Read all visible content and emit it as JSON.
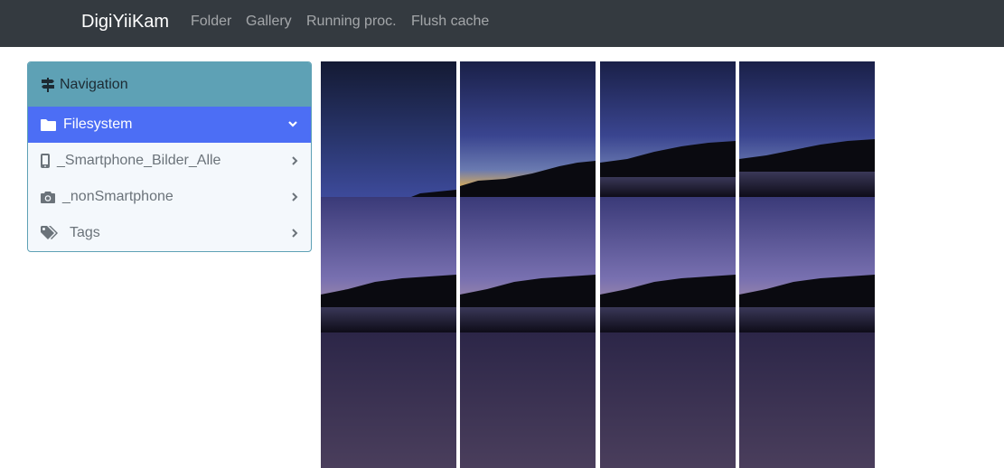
{
  "navbar": {
    "brand": "DigiYiiKam",
    "links": [
      "Folder",
      "Gallery",
      "Running proc.",
      "Flush cache"
    ]
  },
  "sidebar": {
    "header": {
      "label": "Navigation",
      "icon": "signpost-icon"
    },
    "items": [
      {
        "label": "Filesystem",
        "icon": "folder-icon",
        "active": true,
        "chevron": "chevron-down-icon"
      },
      {
        "label": "_Smartphone_Bilder_Alle",
        "icon": "smartphone-icon",
        "chevron": "chevron-right-icon"
      },
      {
        "label": "_nonSmartphone",
        "icon": "camera-icon",
        "chevron": "chevron-right-icon"
      },
      {
        "label": "Tags",
        "icon": "tags-icon",
        "chevron": "chevron-right-icon"
      }
    ]
  },
  "gallery": {
    "thumbnails": [
      {
        "alt": "night sky photo 1"
      },
      {
        "alt": "night sky photo 2"
      },
      {
        "alt": "night sky photo 3"
      },
      {
        "alt": "night sky photo 4"
      },
      {
        "alt": "night sky photo 5"
      },
      {
        "alt": "night sky photo 6"
      },
      {
        "alt": "night sky photo 7"
      },
      {
        "alt": "night sky photo 8"
      },
      {
        "alt": "night sky photo 9"
      },
      {
        "alt": "night sky photo 10"
      },
      {
        "alt": "night sky photo 11"
      },
      {
        "alt": "night sky photo 12"
      }
    ]
  },
  "colors": {
    "navbar_bg": "#343a40",
    "sidebar_header_bg": "#5ea1b5",
    "active_item_bg": "#4c6ef5",
    "sidebar_item_bg": "#f4f8fc"
  }
}
